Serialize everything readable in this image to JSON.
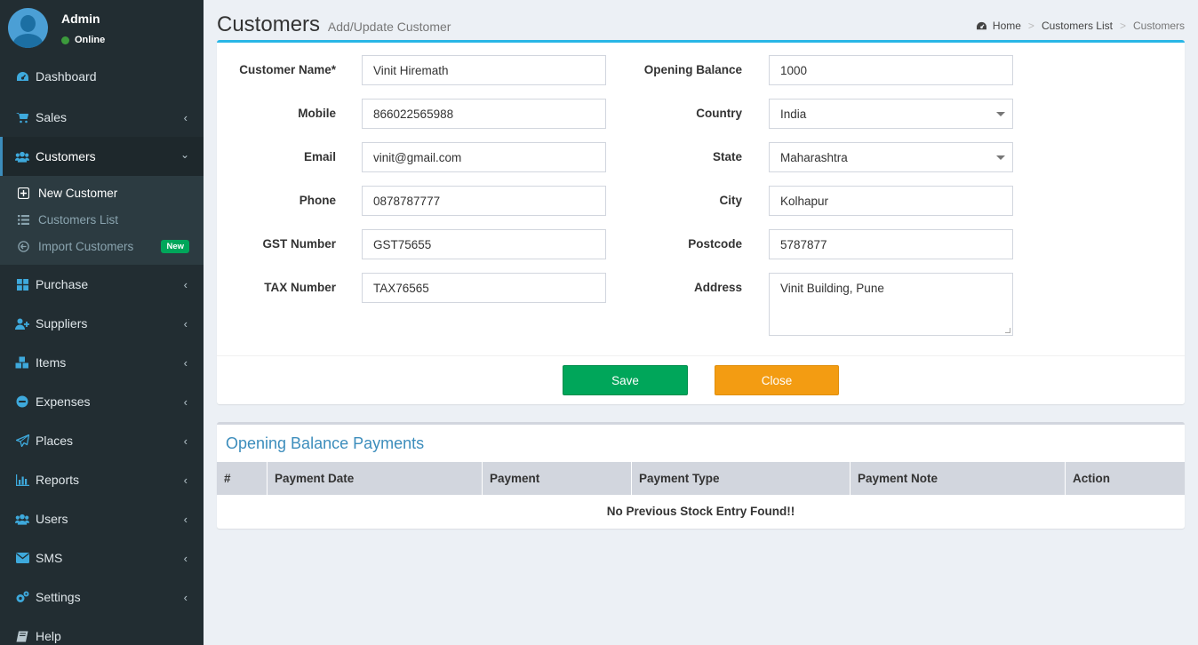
{
  "user": {
    "name": "Admin",
    "status": "Online"
  },
  "sidebar": {
    "items": [
      {
        "label": "Dashboard",
        "icon": "dashboard-icon"
      },
      {
        "label": "Sales",
        "icon": "cart-icon"
      },
      {
        "label": "Customers",
        "icon": "users-icon"
      },
      {
        "label": "Purchase",
        "icon": "grid-icon"
      },
      {
        "label": "Suppliers",
        "icon": "user-plus-icon"
      },
      {
        "label": "Items",
        "icon": "cubes-icon"
      },
      {
        "label": "Expenses",
        "icon": "minus-circle-icon"
      },
      {
        "label": "Places",
        "icon": "paper-plane-icon"
      },
      {
        "label": "Reports",
        "icon": "bar-chart-icon"
      },
      {
        "label": "Users",
        "icon": "users-icon"
      },
      {
        "label": "SMS",
        "icon": "envelope-icon"
      },
      {
        "label": "Settings",
        "icon": "gears-icon"
      },
      {
        "label": "Help",
        "icon": "book-icon"
      }
    ],
    "customers_sub": [
      {
        "label": "New Customer",
        "icon": "plus-square-icon"
      },
      {
        "label": "Customers List",
        "icon": "list-icon"
      },
      {
        "label": "Import Customers",
        "icon": "arrow-circle-left-icon",
        "badge": "New"
      }
    ]
  },
  "header": {
    "title": "Customers",
    "subtitle": "Add/Update Customer"
  },
  "breadcrumb": {
    "home": "Home",
    "list": "Customers List",
    "current": "Customers"
  },
  "form": {
    "customer_name": {
      "label": "Customer Name*",
      "value": "Vinit Hiremath"
    },
    "mobile": {
      "label": "Mobile",
      "value": "866022565988"
    },
    "email": {
      "label": "Email",
      "value": "vinit@gmail.com"
    },
    "phone": {
      "label": "Phone",
      "value": "0878787777"
    },
    "gst": {
      "label": "GST Number",
      "value": "GST75655"
    },
    "tax": {
      "label": "TAX Number",
      "value": "TAX76565"
    },
    "opening_balance": {
      "label": "Opening Balance",
      "value": "1000"
    },
    "country": {
      "label": "Country",
      "value": "India"
    },
    "state": {
      "label": "State",
      "value": "Maharashtra"
    },
    "city": {
      "label": "City",
      "value": "Kolhapur"
    },
    "postcode": {
      "label": "Postcode",
      "value": "5787877"
    },
    "address": {
      "label": "Address",
      "value": "Vinit Building, Pune"
    }
  },
  "buttons": {
    "save": "Save",
    "close": "Close"
  },
  "payments": {
    "title": "Opening Balance Payments",
    "columns": [
      "#",
      "Payment Date",
      "Payment",
      "Payment Type",
      "Payment Note",
      "Action"
    ],
    "empty_text": "No Previous Stock Entry Found!!"
  },
  "colors": {
    "sidebar": "#222d32",
    "accent": "#29b6e6",
    "save": "#00a65a",
    "close": "#f39c12",
    "link": "#3c8dbc"
  }
}
